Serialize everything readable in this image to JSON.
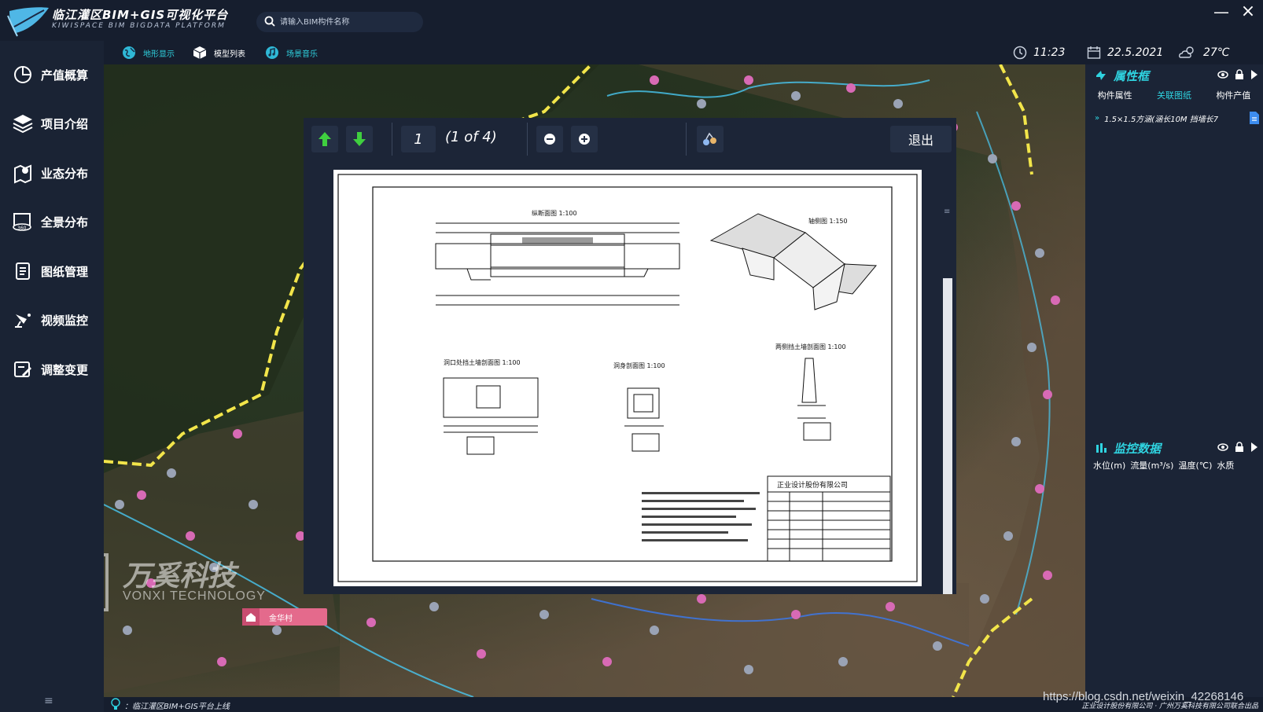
{
  "header": {
    "title": "临江灌区BIM+GIS可视化平台",
    "subtitle": "KIWISPACE BIM BIGDATA PLATFORM",
    "search_placeholder": "请输入BIM构件名称",
    "minimize": "—",
    "close": "×"
  },
  "sidebar": {
    "items": [
      {
        "label": "产值概算",
        "icon": "pie-chart-icon"
      },
      {
        "label": "项目介绍",
        "icon": "layers-icon"
      },
      {
        "label": "业态分布",
        "icon": "map-pin-icon"
      },
      {
        "label": "全景分布",
        "icon": "panorama-360-icon"
      },
      {
        "label": "图纸管理",
        "icon": "document-icon"
      },
      {
        "label": "视频监控",
        "icon": "camera-icon"
      },
      {
        "label": "调整变更",
        "icon": "edit-icon"
      }
    ],
    "menu": "≡"
  },
  "toolbar": {
    "terrain": "地形显示",
    "model_list": "模型列表",
    "scene_music": "场景音乐"
  },
  "status": {
    "time": "11:23",
    "date": "22.5.2021",
    "temperature": "27℃"
  },
  "viewer": {
    "page": "1",
    "page_of": "(1 of 4)",
    "exit": "退出",
    "drawing": {
      "longitudinal": "纵断面图   1:100",
      "axonometric": "轴侧图    1:150",
      "mouth_wall": "洞口处挡土墙剖面图   1:100",
      "body_section": "洞身剖面图   1:100",
      "side_wall": "两侧挡土墙剖面图   1:100",
      "company": "正业设计股份有限公司"
    }
  },
  "properties_panel": {
    "title": "属性框",
    "tabs": [
      "构件属性",
      "关联图纸",
      "构件产值"
    ],
    "active_tab": "关联图纸",
    "item": "1.5×1.5方涵(涵长10M 挡墙长7"
  },
  "monitor_panel": {
    "title": "监控数据",
    "columns": [
      "水位(m)",
      "流量(m³/s)",
      "温度(℃)",
      "水质"
    ]
  },
  "map": {
    "village": "金华村",
    "watermark_title": "万奚科技",
    "watermark_sub": "VONXI TECHNOLOGY"
  },
  "bottom": {
    "message": "：临江灌区BIM+GIS平台上线",
    "copyright": "正业设计股份有限公司 · 广州万奚科技有限公司联合出品",
    "url": "https://blog.csdn.net/weixin_42268146"
  },
  "colors": {
    "accent": "#2fd3e0",
    "panel_bg": "#1b2436",
    "dashed_boundary": "#f2e54a",
    "pin_pink": "#d86ab5",
    "pin_gray": "#9aa3b5"
  }
}
